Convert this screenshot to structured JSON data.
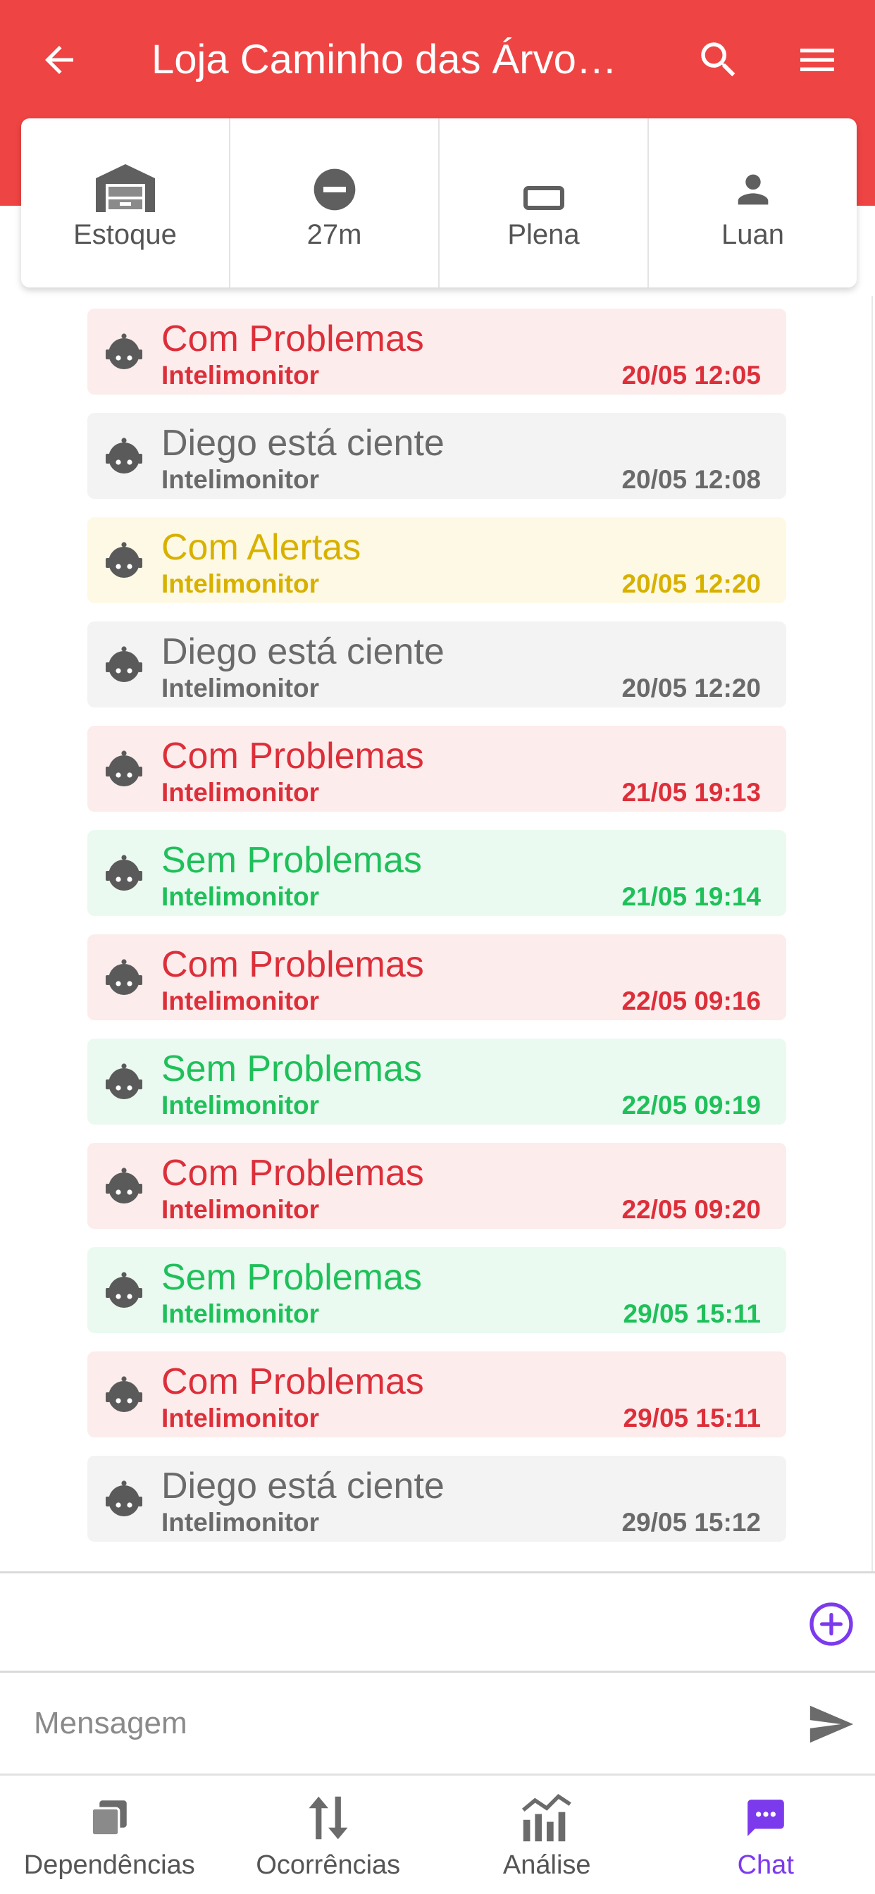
{
  "header": {
    "title": "Loja Caminho das Árvores",
    "color": "#ef4444"
  },
  "info": [
    {
      "icon": "warehouse-icon",
      "label": "Estoque"
    },
    {
      "icon": "minus-circle-icon",
      "label": "27m"
    },
    {
      "icon": "rectangle-icon",
      "label": "Plena"
    },
    {
      "icon": "person-icon",
      "label": "Luan"
    }
  ],
  "messages": [
    {
      "status": "red",
      "title": "Com Problemas",
      "sender": "Intelimonitor",
      "time": "20/05 12:05"
    },
    {
      "status": "gray",
      "title": "Diego está ciente",
      "sender": "Intelimonitor",
      "time": "20/05 12:08"
    },
    {
      "status": "yellow",
      "title": "Com Alertas",
      "sender": "Intelimonitor",
      "time": "20/05 12:20"
    },
    {
      "status": "gray",
      "title": "Diego está ciente",
      "sender": "Intelimonitor",
      "time": "20/05 12:20"
    },
    {
      "status": "red",
      "title": "Com Problemas",
      "sender": "Intelimonitor",
      "time": "21/05 19:13"
    },
    {
      "status": "green",
      "title": "Sem Problemas",
      "sender": "Intelimonitor",
      "time": "21/05 19:14"
    },
    {
      "status": "red",
      "title": "Com Problemas",
      "sender": "Intelimonitor",
      "time": "22/05 09:16"
    },
    {
      "status": "green",
      "title": "Sem Problemas",
      "sender": "Intelimonitor",
      "time": "22/05 09:19"
    },
    {
      "status": "red",
      "title": "Com Problemas",
      "sender": "Intelimonitor",
      "time": "22/05 09:20"
    },
    {
      "status": "green",
      "title": "Sem Problemas",
      "sender": "Intelimonitor",
      "time": "29/05 15:11"
    },
    {
      "status": "red",
      "title": "Com Problemas",
      "sender": "Intelimonitor",
      "time": "29/05 15:11"
    },
    {
      "status": "gray",
      "title": "Diego está ciente",
      "sender": "Intelimonitor",
      "time": "29/05 15:12"
    }
  ],
  "compose": {
    "placeholder": "Mensagem",
    "value": ""
  },
  "nav": [
    {
      "icon": "dependencies-icon",
      "label": "Dependências",
      "active": false
    },
    {
      "icon": "arrows-updown-icon",
      "label": "Ocorrências",
      "active": false
    },
    {
      "icon": "analytics-icon",
      "label": "Análise",
      "active": false
    },
    {
      "icon": "chat-icon",
      "label": "Chat",
      "active": true
    }
  ],
  "colors": {
    "accent": "#7c3aed",
    "red": "#dc2f3a",
    "yellow": "#d8b100",
    "green": "#1fc05a",
    "gray": "#6a6a6a"
  }
}
